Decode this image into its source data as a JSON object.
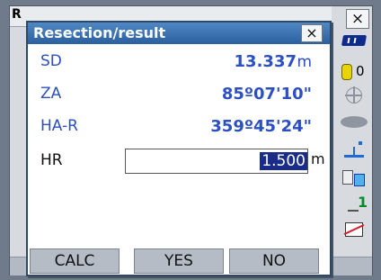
{
  "background_window": {
    "title_char": "R",
    "close_label": "×"
  },
  "status": {
    "prism_constant": "0",
    "mode_number": "1"
  },
  "dialog": {
    "title": "Resection/result",
    "close_label": "×",
    "rows": [
      {
        "label": "SD",
        "value": "13.337",
        "unit": "m"
      },
      {
        "label": "ZA",
        "value": "85º07'10\""
      },
      {
        "label": "HA-R",
        "value": "359º45'24\""
      },
      {
        "label": "HR",
        "value": "1.500",
        "unit": "m"
      }
    ],
    "softkeys": [
      "CALC",
      "YES",
      "NO"
    ]
  },
  "colors": {
    "title_bar": "#2b5f9e",
    "value_text": "#2c4fc2",
    "selection": "#1a2c8a"
  }
}
